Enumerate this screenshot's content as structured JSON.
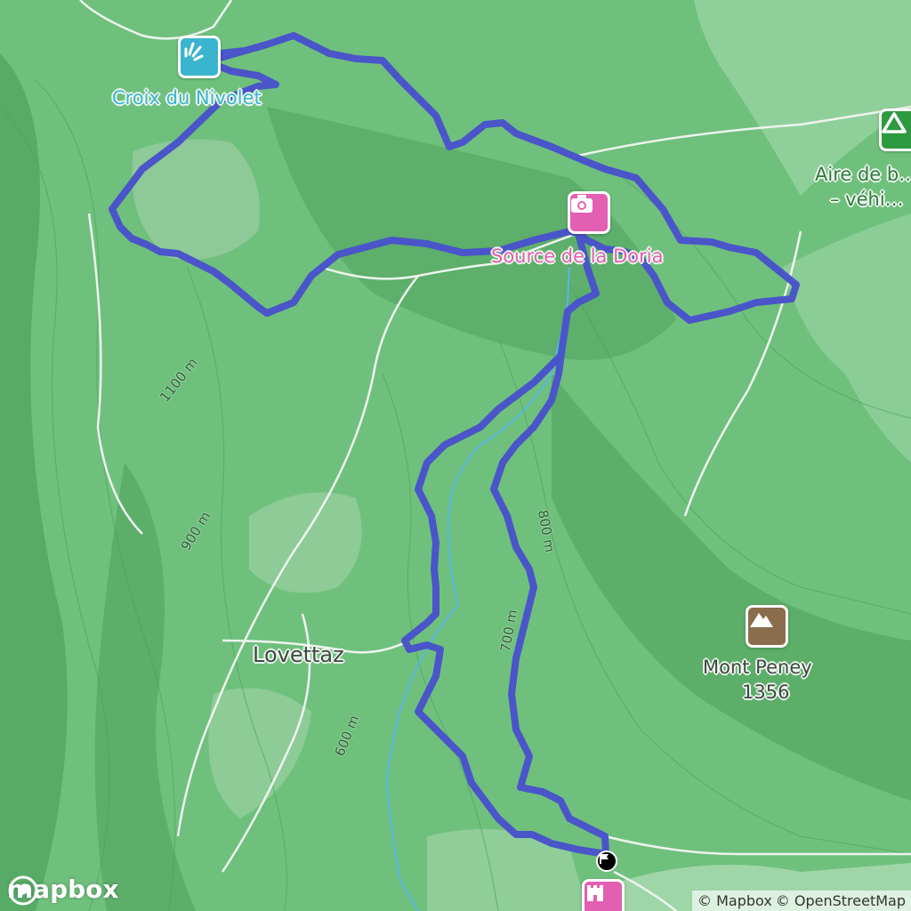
{
  "map": {
    "provider": "mapbox",
    "colors": {
      "forest": "#6fc07d",
      "forest_dark": "#58ab67",
      "meadow": "#a9d7ad",
      "route": "#4a55c9",
      "water": "#5ab4e6",
      "road": "#f2f5f2"
    },
    "pois": [
      {
        "name": "Croix du Nivolet",
        "type": "viewpoint",
        "icon": "viewpoint-icon",
        "color": "#3bb4cf"
      },
      {
        "name": "Source de la Doria",
        "type": "photo-spot",
        "icon": "camera-icon",
        "color": "#e35fb2"
      },
      {
        "name": "Aire de b…",
        "name_line2": "– véhi…",
        "type": "camping",
        "icon": "tent-icon",
        "color": "#2e9a3f"
      },
      {
        "name": "Mont Peney",
        "elevation": "1356",
        "type": "peak",
        "icon": "mountain-icon",
        "color": "#8a6d4c"
      },
      {
        "name": "",
        "type": "castle",
        "icon": "castle-icon",
        "color": "#e35fb2"
      }
    ],
    "places": [
      {
        "name": "Lovettaz",
        "type": "locality"
      }
    ],
    "contour_labels": [
      "1100 m",
      "900 m",
      "800 m",
      "700 m",
      "600 m"
    ],
    "route": {
      "start_marker_icon": "flag-icon"
    },
    "branding": {
      "logo_text": "mapbox"
    },
    "attribution": {
      "mapbox": "© Mapbox",
      "osm": "© OpenStreetMap"
    }
  }
}
